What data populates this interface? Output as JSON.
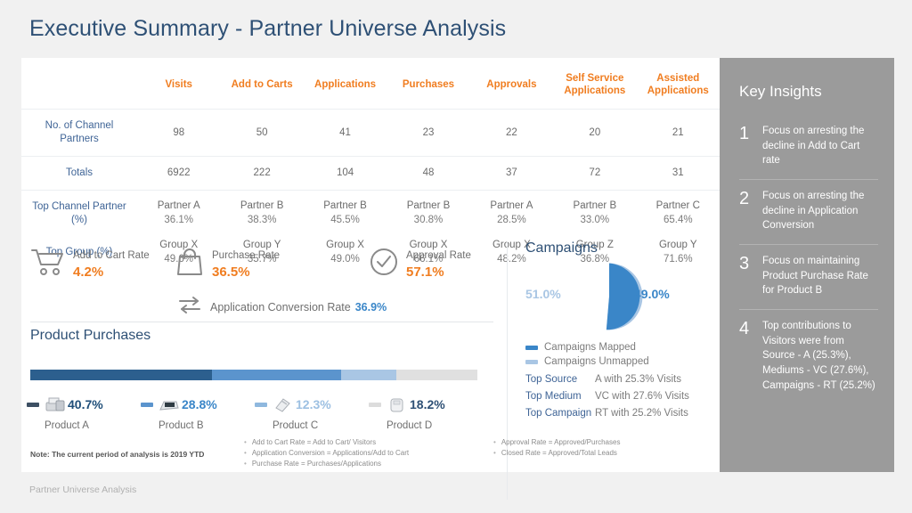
{
  "title": "Executive Summary - Partner Universe Analysis",
  "footer": "Partner Universe Analysis",
  "colors": {
    "accent_orange": "#f07d20",
    "title_blue": "#2e5075",
    "label_blue": "#3f6496",
    "link_blue": "#3a86c8",
    "panel_gray": "#9b9b9b",
    "product_a": "#2c5f8e",
    "product_b": "#5b94cd",
    "product_c": "#a9c6e4",
    "product_d": "#e0e0e0",
    "pie_mapped": "#3a86c8",
    "pie_unmapped": "#a9c6e4"
  },
  "table": {
    "headers": [
      "",
      "Visits",
      "Add to Carts",
      "Applications",
      "Purchases",
      "Approvals",
      "Self Service Applications",
      "Assisted Applications"
    ],
    "rows": [
      {
        "label": "No. of Channel Partners",
        "values": [
          "98",
          "50",
          "41",
          "23",
          "22",
          "20",
          "21"
        ]
      },
      {
        "label": "Totals",
        "values": [
          "6922",
          "222",
          "104",
          "48",
          "37",
          "72",
          "31"
        ]
      },
      {
        "label": "Top Channel Partner (%)",
        "names": [
          "Partner A",
          "Partner B",
          "Partner B",
          "Partner B",
          "Partner A",
          "Partner B",
          "Partner C"
        ],
        "pcts": [
          "36.1%",
          "38.3%",
          "45.5%",
          "30.8%",
          "28.5%",
          "33.0%",
          "65.4%"
        ]
      },
      {
        "label": "Top Group (%)",
        "names": [
          "Group X",
          "Group Y",
          "Group X",
          "Group X",
          "Group X",
          "Group Z",
          "Group Y"
        ],
        "pcts": [
          "49.6%",
          "35.7%",
          "49.0%",
          "66.1%",
          "48.2%",
          "36.8%",
          "71.6%"
        ]
      }
    ]
  },
  "rates": {
    "add_to_cart": {
      "label": "Add to Cart Rate",
      "value": "4.2%",
      "icon": "shopping-cart-icon"
    },
    "purchase": {
      "label": "Purchase Rate",
      "value": "36.5%",
      "icon": "shopping-bag-icon"
    },
    "approval": {
      "label": "Approval Rate",
      "value": "57.1%",
      "icon": "check-circle-icon"
    },
    "app_conversion": {
      "label": "Application Conversion Rate",
      "value": "36.9%",
      "icon": "exchange-arrows-icon"
    }
  },
  "product_purchases": {
    "title": "Product Purchases",
    "chart_data": {
      "type": "bar",
      "title": "Product Purchases",
      "categories": [
        "Product A",
        "Product B",
        "Product C",
        "Product D"
      ],
      "values": [
        40.7,
        28.8,
        12.3,
        18.2
      ],
      "labels": [
        "40.7%",
        "28.8%",
        "12.3%",
        "18.2%"
      ],
      "colors": [
        "#2c5f8e",
        "#5b94cd",
        "#a9c6e4",
        "#e0e0e0"
      ],
      "xlabel": "",
      "ylabel": "",
      "ylim": [
        0,
        100
      ],
      "grid": false,
      "legend": "bottom"
    }
  },
  "campaigns": {
    "title": "Campaigns",
    "chart_data": {
      "type": "pie",
      "title": "Campaigns",
      "categories": [
        "Campaigns Unmapped",
        "Campaigns Mapped"
      ],
      "values": [
        51.0,
        49.0
      ],
      "labels": [
        "51.0%",
        "49.0%"
      ],
      "colors": [
        "#a9c6e4",
        "#3a86c8"
      ],
      "legend": "bottom"
    },
    "left_pct": "51.0%",
    "right_pct": "49.0%",
    "legend": [
      {
        "label": "Campaigns Mapped",
        "color": "#3a86c8"
      },
      {
        "label": "Campaigns Unmapped",
        "color": "#a9c6e4"
      }
    ],
    "rows": [
      {
        "key": "Top Source",
        "value": "A with 25.3% Visits"
      },
      {
        "key": "Top Medium",
        "value": "VC with 27.6% Visits"
      },
      {
        "key": "Top Campaign",
        "value": "RT with 25.2% Visits"
      }
    ]
  },
  "footnotes": {
    "note": "Note: The current period of analysis is 2019 YTD",
    "left_bullets": [
      "Add to Cart Rate = Add to Cart/ Visitors",
      "Application Conversion = Applications/Add to Cart",
      "Purchase Rate = Purchases/Applications"
    ],
    "right_bullets": [
      "Approval Rate = Approved/Purchases",
      "Closed Rate = Approved/Total Leads"
    ]
  },
  "insights": {
    "title": "Key Insights",
    "items": [
      {
        "num": "1",
        "text": "Focus on arresting the decline in Add to Cart rate"
      },
      {
        "num": "2",
        "text": "Focus on arresting the decline in Application Conversion"
      },
      {
        "num": "3",
        "text": "Focus on maintaining Product Purchase Rate for Product B"
      },
      {
        "num": "4",
        "text": "Top contributions to Visitors were from Source - A (25.3%), Mediums - VC (27.6%), Campaigns - RT (25.2%)"
      }
    ]
  }
}
